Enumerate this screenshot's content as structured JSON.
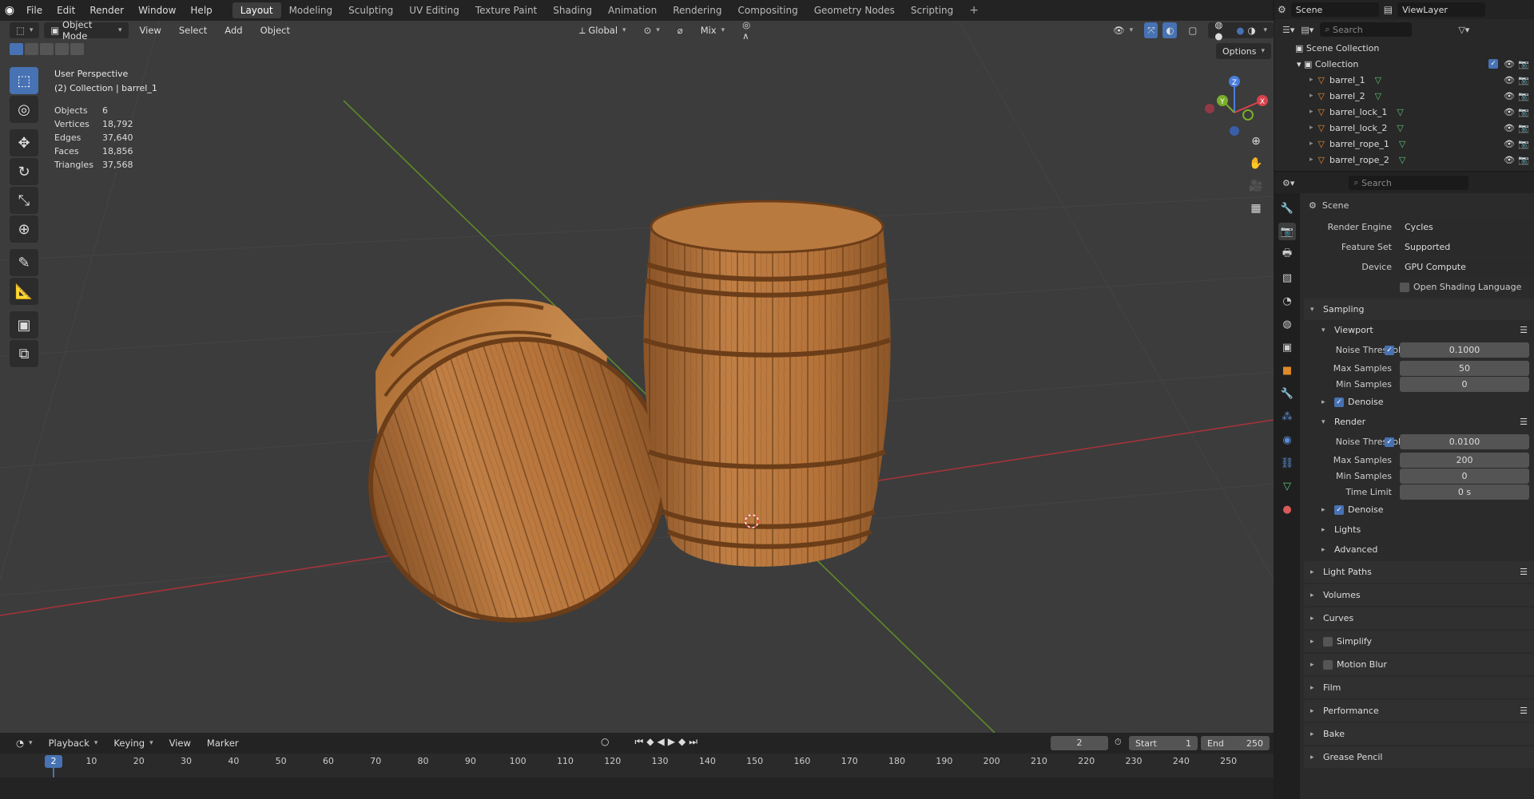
{
  "menu": [
    "File",
    "Edit",
    "Render",
    "Window",
    "Help"
  ],
  "workspaces": [
    "Layout",
    "Modeling",
    "Sculpting",
    "UV Editing",
    "Texture Paint",
    "Shading",
    "Animation",
    "Rendering",
    "Compositing",
    "Geometry Nodes",
    "Scripting"
  ],
  "active_workspace": "Layout",
  "top_right": {
    "scene": "Scene",
    "view_layer": "ViewLayer"
  },
  "viewport": {
    "mode": "Object Mode",
    "menus": [
      "View",
      "Select",
      "Add",
      "Object"
    ],
    "orientation": "Global",
    "blend": "Mix",
    "options": "Options",
    "perspective": "User Perspective",
    "collection": "(2) Collection | barrel_1",
    "stats": [
      {
        "k": "Objects",
        "v": "6"
      },
      {
        "k": "Vertices",
        "v": "18,792"
      },
      {
        "k": "Edges",
        "v": "37,640"
      },
      {
        "k": "Faces",
        "v": "18,856"
      },
      {
        "k": "Triangles",
        "v": "37,568"
      }
    ],
    "gizmo": {
      "x": "X",
      "y": "Y",
      "z": "Z"
    },
    "colors": {
      "x_axis": "#c0393f",
      "y_axis": "#6b9b2e",
      "wood": "#b5733a"
    }
  },
  "outliner": {
    "search_placeholder": "Search",
    "scene_collection": "Scene Collection",
    "collection": "Collection",
    "items": [
      "barrel_1",
      "barrel_2",
      "barrel_lock_1",
      "barrel_lock_2",
      "barrel_rope_1",
      "barrel_rope_2"
    ]
  },
  "properties": {
    "search_placeholder": "Search",
    "context": "Scene",
    "render_engine_label": "Render Engine",
    "render_engine": "Cycles",
    "feature_set_label": "Feature Set",
    "feature_set": "Supported",
    "device_label": "Device",
    "device": "GPU Compute",
    "osl": "Open Shading Language",
    "sampling": "Sampling",
    "viewport": "Viewport",
    "render": "Render",
    "noise_threshold_label": "Noise Threshold",
    "max_samples_label": "Max Samples",
    "min_samples_label": "Min Samples",
    "time_limit_label": "Time Limit",
    "vp_noise": "0.1000",
    "vp_max": "50",
    "vp_min": "0",
    "r_noise": "0.0100",
    "r_max": "200",
    "r_min": "0",
    "r_time": "0 s",
    "denoise": "Denoise",
    "lights": "Lights",
    "advanced": "Advanced",
    "sections": [
      "Light Paths",
      "Volumes",
      "Curves",
      "Simplify",
      "Motion Blur",
      "Film",
      "Performance",
      "Bake",
      "Grease Pencil"
    ]
  },
  "timeline": {
    "menus": [
      "Playback",
      "Keying",
      "View",
      "Marker"
    ],
    "current_frame": "2",
    "start_label": "Start",
    "start": "1",
    "end_label": "End",
    "end": "250",
    "ticks": [
      "10",
      "20",
      "30",
      "40",
      "50",
      "60",
      "70",
      "80",
      "90",
      "100",
      "110",
      "120",
      "130",
      "140",
      "150",
      "160",
      "170",
      "180",
      "190",
      "200",
      "210",
      "220",
      "230",
      "240",
      "250"
    ]
  }
}
